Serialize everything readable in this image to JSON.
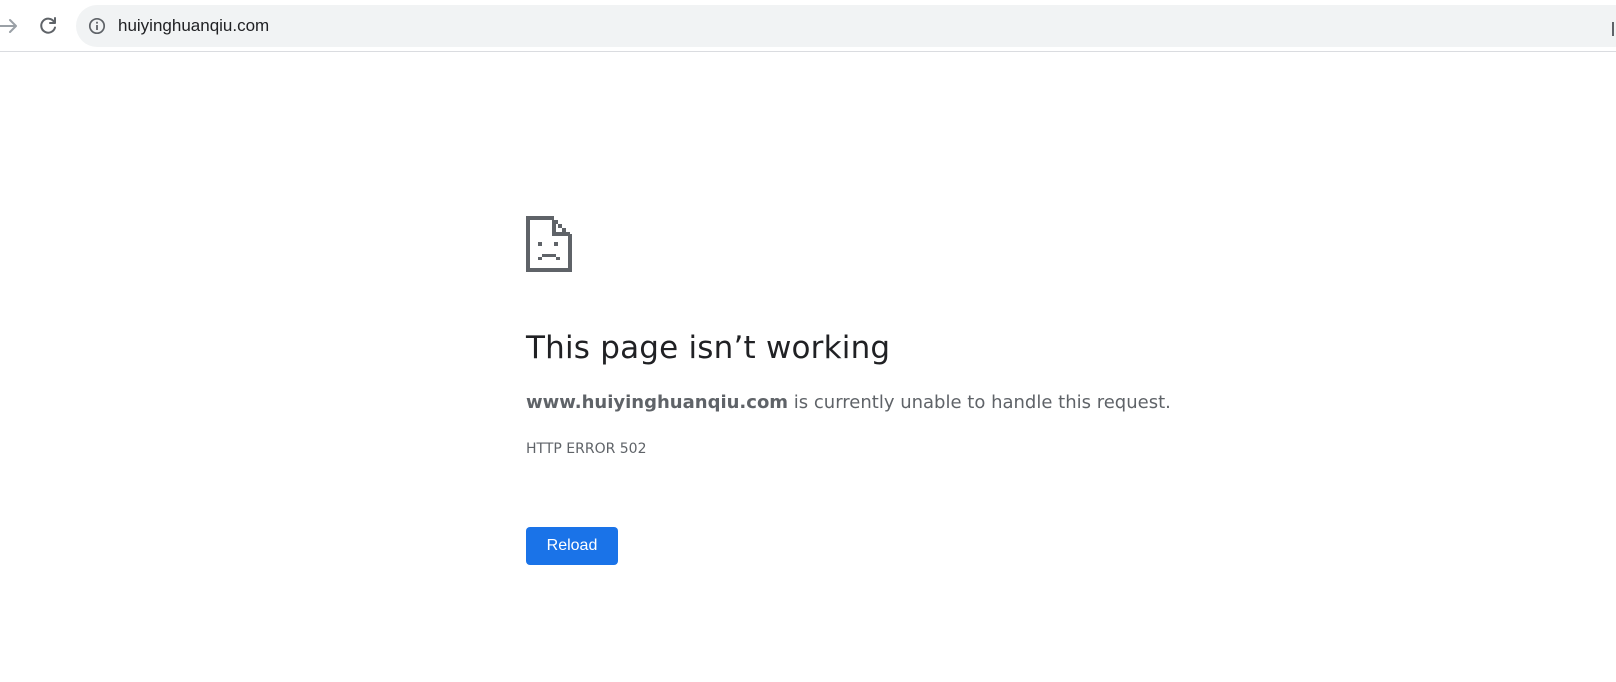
{
  "browser": {
    "url": "huiyinghuanqiu.com",
    "icons": {
      "forward": "arrow-forward-icon",
      "reload": "reload-icon",
      "site_info": "info-icon"
    }
  },
  "error_page": {
    "icon": "sad-page-icon",
    "heading": "This page isn’t working",
    "summary_host": "www.huiyinghuanqiu.com",
    "summary_rest": " is currently unable to handle this request.",
    "error_code": "HTTP ERROR 502",
    "reload_label": "Reload"
  },
  "colors": {
    "accent": "#1a73e8",
    "heading": "#202124",
    "body_text": "#5f6368",
    "omnibox_bg": "#f1f3f4"
  }
}
